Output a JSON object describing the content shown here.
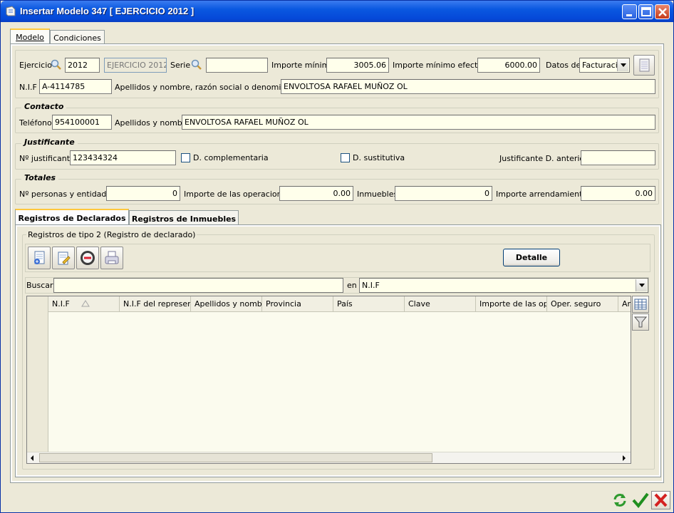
{
  "window": {
    "title": "Insertar Modelo 347 [ EJERCICIO 2012 ]"
  },
  "tabs": [
    {
      "label": "Modelo"
    },
    {
      "label": "Condiciones"
    }
  ],
  "header": {
    "ejercicio_label": "Ejercicio",
    "ejercicio_value": "2012",
    "ejercicio_desc": "EJERCICIO 2012",
    "serie_label": "Serie",
    "serie_value": "",
    "importe_minimo_label": "Importe mínimo",
    "importe_minimo_value": "3005.06",
    "importe_minimo_efectivo_label": "Importe mínimo efectivo",
    "importe_minimo_efectivo_value": "6000.00",
    "datos_de_label": "Datos de",
    "datos_de_value": "Facturació",
    "nif_label": "N.I.F",
    "nif_value": "A-4114785",
    "razon_label": "Apellidos y nombre, razón social o denominación",
    "razon_value": "ENVOLTOSA RAFAEL MUÑOZ OL"
  },
  "contacto": {
    "title": "Contacto",
    "telefono_label": "Teléfono",
    "telefono_value": "954100001",
    "nombre_label": "Apellidos y nombre",
    "nombre_value": "ENVOLTOSA RAFAEL MUÑOZ OL"
  },
  "justificante": {
    "title": "Justificante",
    "numero_label": "Nº justificante",
    "numero_value": "123434324",
    "complementaria_label": "D. complementaria",
    "sustitutiva_label": "D. sustitutiva",
    "anterior_label": "Justificante D. anterior",
    "anterior_value": ""
  },
  "totales": {
    "title": "Totales",
    "personas_label": "Nº personas y entidades",
    "personas_value": "0",
    "operaciones_label": "Importe de las operaciones",
    "operaciones_value": "0.00",
    "inmuebles_label": "Inmuebles",
    "inmuebles_value": "0",
    "arrendamientos_label": "Importe arrendamientos",
    "arrendamientos_value": "0.00"
  },
  "subtabs": [
    {
      "label": "Registros de Declarados"
    },
    {
      "label": "Registros de Inmuebles"
    }
  ],
  "registros": {
    "group_title": "Registros de tipo 2 (Registro de declarado)",
    "detalle_label": "Detalle",
    "buscar_label": "Buscar",
    "buscar_value": "",
    "en_label": "en",
    "en_value": "N.I.F",
    "columns": [
      "N.I.F",
      "N.I.F del represent",
      "Apellidos y nombre",
      "Provincia",
      "País",
      "Clave",
      "Importe de las oper",
      "Oper. seguro",
      "Ar"
    ]
  },
  "colors": {
    "titlebar": "#0548d8",
    "panel": "#ece9d8",
    "field_bg": "#ffffeb",
    "grid_bg": "#fbfbee"
  },
  "icons": [
    "window-icon",
    "search-icon",
    "new-record-icon",
    "edit-record-icon",
    "delete-record-icon",
    "print-icon",
    "grid-columns-icon",
    "filter-icon",
    "refresh-icon",
    "accept-icon",
    "cancel-icon"
  ]
}
